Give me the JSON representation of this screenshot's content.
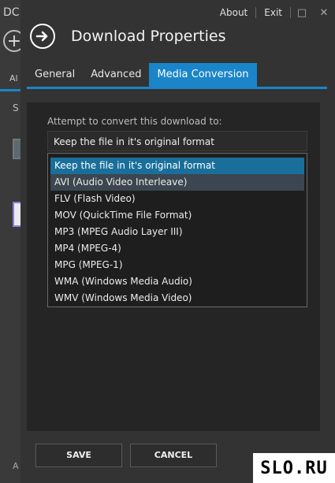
{
  "background_app": {
    "title_fragment": "DC",
    "add_symbol": "+",
    "tab_fragment": "Al",
    "section_fragment": "S",
    "bottom_fragment": "A"
  },
  "topnav": {
    "about": "About",
    "exit": "Exit",
    "maximize_symbol": "□",
    "close_symbol": "✕"
  },
  "dialog": {
    "title": "Download Properties",
    "tabs": [
      {
        "label": "General"
      },
      {
        "label": "Advanced"
      },
      {
        "label": "Media Conversion"
      }
    ],
    "active_tab": "Media Conversion",
    "prompt": "Attempt to convert this download to:",
    "selected_value": "Keep the file in it's original format",
    "options": [
      "Keep the file in it's original format",
      "AVI (Audio Video Interleave)",
      "FLV (Flash Video)",
      "MOV (QuickTime File Format)",
      "MP3 (MPEG Audio Layer III)",
      "MP4 (MPEG-4)",
      "MPG (MPEG-1)",
      "WMA (Windows Media Audio)",
      "WMV (Windows Media Video)"
    ],
    "save_label": "SAVE",
    "cancel_label": "CANCEL"
  },
  "watermark": "SLO.RU",
  "colors": {
    "accent": "#1a85c9",
    "selected": "#1a6f9a"
  }
}
